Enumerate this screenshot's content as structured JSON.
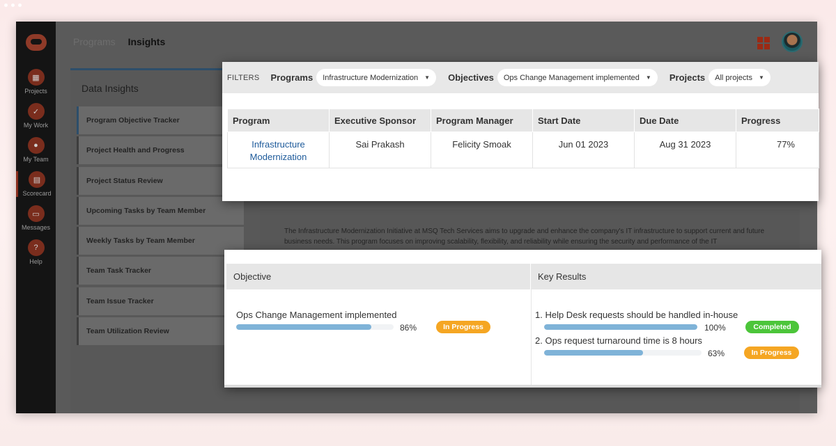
{
  "breadcrumb": {
    "item1": "Programs",
    "item2": "Insights"
  },
  "rail": {
    "items": [
      {
        "label": "Projects",
        "icon": "projects-icon"
      },
      {
        "label": "My Work",
        "icon": "check-icon"
      },
      {
        "label": "My Team",
        "icon": "team-icon"
      },
      {
        "label": "Scorecard",
        "icon": "scorecard-icon"
      },
      {
        "label": "Messages",
        "icon": "messages-icon"
      },
      {
        "label": "Help",
        "icon": "help-icon",
        "glyph": "?"
      }
    ]
  },
  "insights": {
    "title": "Data Insights",
    "items": [
      "Program Objective Tracker",
      "Project Health and Progress",
      "Project Status Review",
      "Upcoming Tasks by Team Member",
      "Weekly Tasks by Team Member",
      "Team Task Tracker",
      "Team Issue Tracker",
      "Team Utilization Review"
    ]
  },
  "background_text": "The Infrastructure Modernization Initiative at MSQ Tech Services aims to upgrade and enhance the company's IT infrastructure to support current and future business needs. This program focuses on improving scalability, flexibility, and reliability while ensuring the security and performance of the IT",
  "filters": {
    "label": "FILTERS",
    "programs_label": "Programs",
    "programs_value": "Infrastructure Modernization",
    "objectives_label": "Objectives",
    "objectives_value": "Ops Change Management implemented",
    "projects_label": "Projects",
    "projects_value": "All projects"
  },
  "program_table": {
    "headers": [
      "Program",
      "Executive Sponsor",
      "Program Manager",
      "Start Date",
      "Due Date",
      "Progress"
    ],
    "row": {
      "program_line1": "Infrastructure",
      "program_line2": "Modernization",
      "sponsor": "Sai Prakash",
      "manager": "Felicity Smoak",
      "start": "Jun 01 2023",
      "due": "Aug 31 2023",
      "progress": "77%"
    }
  },
  "okr": {
    "header_objective": "Objective",
    "header_key_results": "Key Results",
    "objective": {
      "title": "Ops Change Management implemented",
      "progress": 0.86,
      "progress_text": "86%",
      "status": "In Progress"
    },
    "key_results": [
      {
        "title": "1. Help Desk requests should be handled in-house",
        "progress": 1.0,
        "progress_text": "100%",
        "status": "Completed"
      },
      {
        "title": "2. Ops request turnaround time is 8 hours",
        "progress": 0.63,
        "progress_text": "63%",
        "status": "In Progress"
      }
    ]
  },
  "colors": {
    "accent": "#1d5a9a",
    "in_progress": "#f5a623",
    "completed": "#4cc53a",
    "bar_fill": "#7fb3d8",
    "brand": "#9b2a14"
  }
}
